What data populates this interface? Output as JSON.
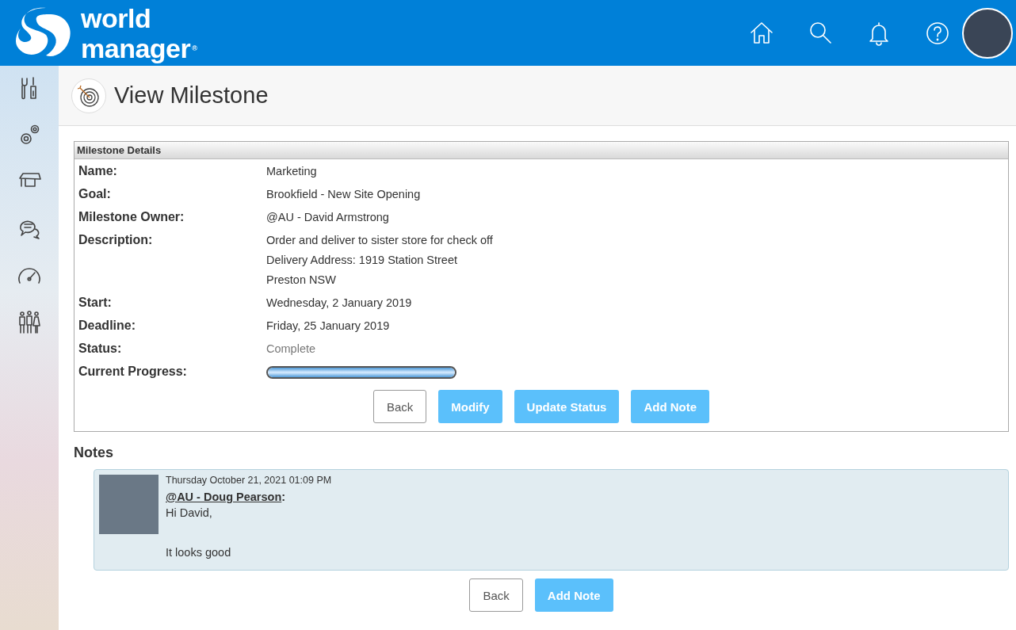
{
  "header": {
    "logo_line_1": "world",
    "logo_line_2": "manager",
    "logo_mark": "®"
  },
  "page": {
    "title": "View Milestone"
  },
  "details": {
    "heading": "Milestone Details",
    "fields": [
      {
        "label": "Name:",
        "lines": [
          "Marketing"
        ],
        "kind": "text"
      },
      {
        "label": "Goal:",
        "lines": [
          "Brookfield - New Site Opening"
        ],
        "kind": "text"
      },
      {
        "label": "Milestone Owner:",
        "lines": [
          "@AU - David Armstrong"
        ],
        "kind": "text"
      },
      {
        "label": "Description:",
        "lines": [
          "Order and deliver to sister store for check off",
          "Delivery Address: 1919 Station Street",
          "Preston NSW"
        ],
        "kind": "text"
      },
      {
        "label": "Start:",
        "lines": [
          "Wednesday, 2 January 2019"
        ],
        "kind": "text"
      },
      {
        "label": "Deadline:",
        "lines": [
          "Friday, 25 January 2019"
        ],
        "kind": "text"
      },
      {
        "label": "Status:",
        "lines": [
          "Complete"
        ],
        "kind": "status"
      },
      {
        "label": "Current Progress:",
        "level": 1.0,
        "kind": "progress"
      }
    ],
    "buttons": [
      {
        "label": "Back",
        "kind": "secondary"
      },
      {
        "label": "Modify",
        "kind": "primary"
      },
      {
        "label": "Update Status",
        "kind": "primary"
      },
      {
        "label": "Add Note",
        "kind": "primary"
      }
    ]
  },
  "notes": {
    "heading": "Notes",
    "items": [
      {
        "timestamp": "Thursday October 21, 2021 01:09 PM",
        "author": "@AU - Doug Pearson",
        "author_suffix": ":",
        "paragraphs": [
          "Hi David,",
          "It looks good"
        ]
      }
    ],
    "buttons": [
      {
        "label": "Back",
        "kind": "secondary"
      },
      {
        "label": "Add Note",
        "kind": "primary"
      }
    ]
  }
}
